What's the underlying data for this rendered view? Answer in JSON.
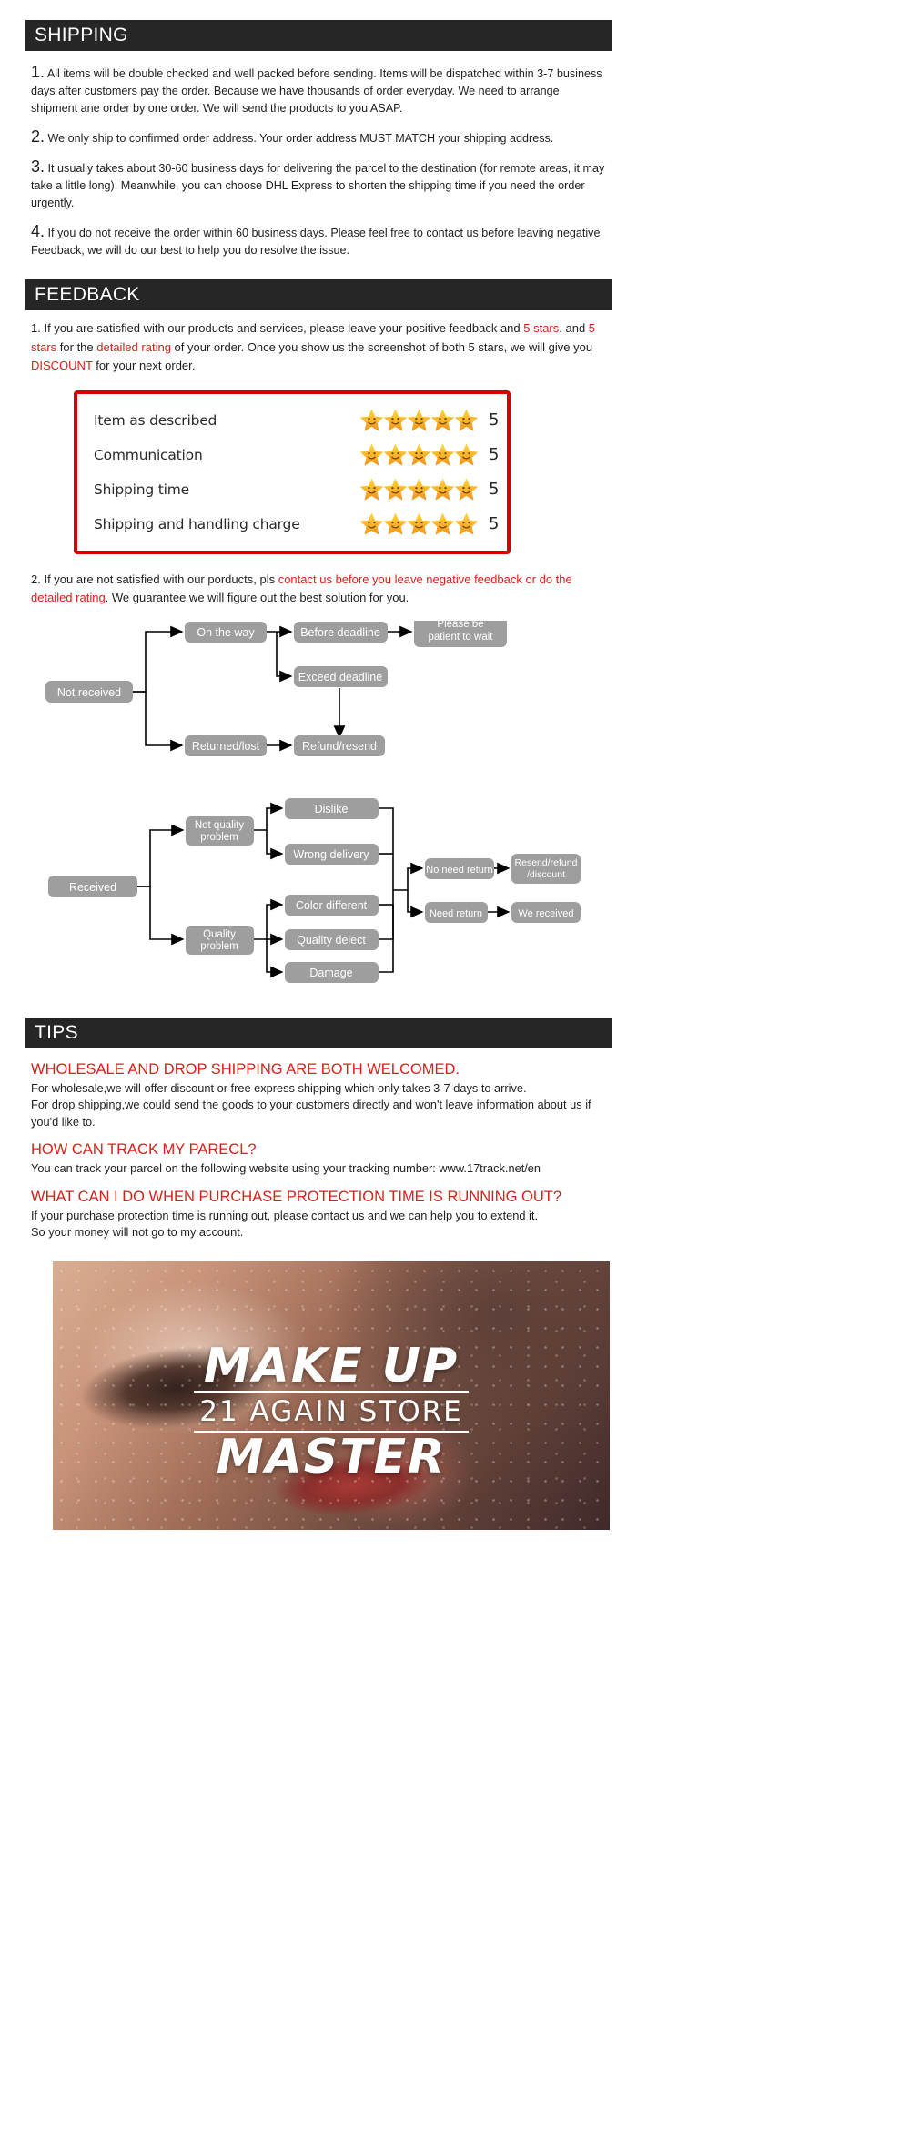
{
  "shipping": {
    "header": "SHIPPING",
    "items": [
      {
        "num": "1.",
        "text": "All items will be double checked and well packed before sending. Items will be dispatched within 3-7 business days after customers pay the order. Because we have thousands of order everyday. We need to arrange shipment ane order by one order. We will send the products to you ASAP."
      },
      {
        "num": "2.",
        "text": "We only ship to confirmed order address. Your order address MUST MATCH  your shipping address."
      },
      {
        "num": "3.",
        "text": "It usually takes about 30-60 business days for delivering the parcel to the destination (for remote areas, it may take a little long). Meanwhile, you can choose DHL Express to shorten the shipping time if you need the order urgently."
      },
      {
        "num": "4.",
        "text": "If you do not receive the order within 60 business days. Please feel free to contact us before leaving negative Feedback, we will do our best to help you do resolve the issue."
      }
    ]
  },
  "feedback": {
    "header": "FEEDBACK",
    "point1": {
      "seg1": "1. If you are satisfied with our products and services, please leave your positive feedback and ",
      "seg2_red": "5 stars",
      "seg3": ". and ",
      "seg4_red": "5 stars",
      "seg5": " for the ",
      "seg6_red": "detailed rating",
      "seg7": " of your order. Once you show us the screenshot of both 5 stars, we will give you ",
      "seg8_red": "DISCOUNT",
      "seg9": " for your next order."
    },
    "rating_box": {
      "border_color": "#d60000",
      "rows": [
        {
          "label": "Item as described",
          "stars": 5,
          "value": "5"
        },
        {
          "label": "Communication",
          "stars": 5,
          "value": "5"
        },
        {
          "label": "Shipping time",
          "stars": 5,
          "value": "5"
        },
        {
          "label": "Shipping and handling charge",
          "stars": 5,
          "value": "5"
        }
      ]
    },
    "point2": {
      "seg1": "2. If you are not satisfied with our porducts, pls ",
      "seg2_red": "contact us before you leave negative feedback or do the detailed rating",
      "seg3": ". We guarantee we will figure out the best solution for you."
    }
  },
  "flow_not_received": {
    "nodes": {
      "not_received": "Not received",
      "on_the_way": "On the way",
      "before_deadline": "Before deadline",
      "exceed_deadline": "Exceed deadline",
      "please_be_patient": "Please be patient to wait",
      "returned_lost": "Returned/lost",
      "refund_resend": "Refund/resend"
    }
  },
  "flow_received": {
    "nodes": {
      "received": "Received",
      "not_quality_problem": "Not quality problem",
      "dislike": "Dislike",
      "wrong_delivery": "Wrong delivery",
      "quality_problem": "Quality problem",
      "color_different": "Color different",
      "quality_delect": "Quality delect",
      "damage": "Damage",
      "no_need_return": "No need return",
      "need_return": "Need return",
      "resend_refund_discount": "Resend/refund /discount",
      "we_received": "We received"
    }
  },
  "tips": {
    "header": "TIPS",
    "blocks": [
      {
        "heading": "WHOLESALE AND DROP SHIPPING ARE BOTH WELCOMED.",
        "body": "For wholesale,we will offer discount or free express shipping which only takes 3-7 days to arrive.\nFor drop shipping,we could send the goods to your customers directly and won't leave information about us if you'd like to."
      },
      {
        "heading": "HOW CAN TRACK MY PARECL?",
        "body": "You can track your parcel on the following website using your tracking number: www.17track.net/en"
      },
      {
        "heading": "WHAT CAN I DO WHEN PURCHASE PROTECTION TIME IS RUNNING OUT?",
        "body": "If your purchase protection time is running out, please contact us and we can help you to extend it.\nSo your money will not go to my account."
      }
    ]
  },
  "banner": {
    "line1": "MAKE UP",
    "line2": "21 AGAIN STORE",
    "line3": "MASTER"
  }
}
